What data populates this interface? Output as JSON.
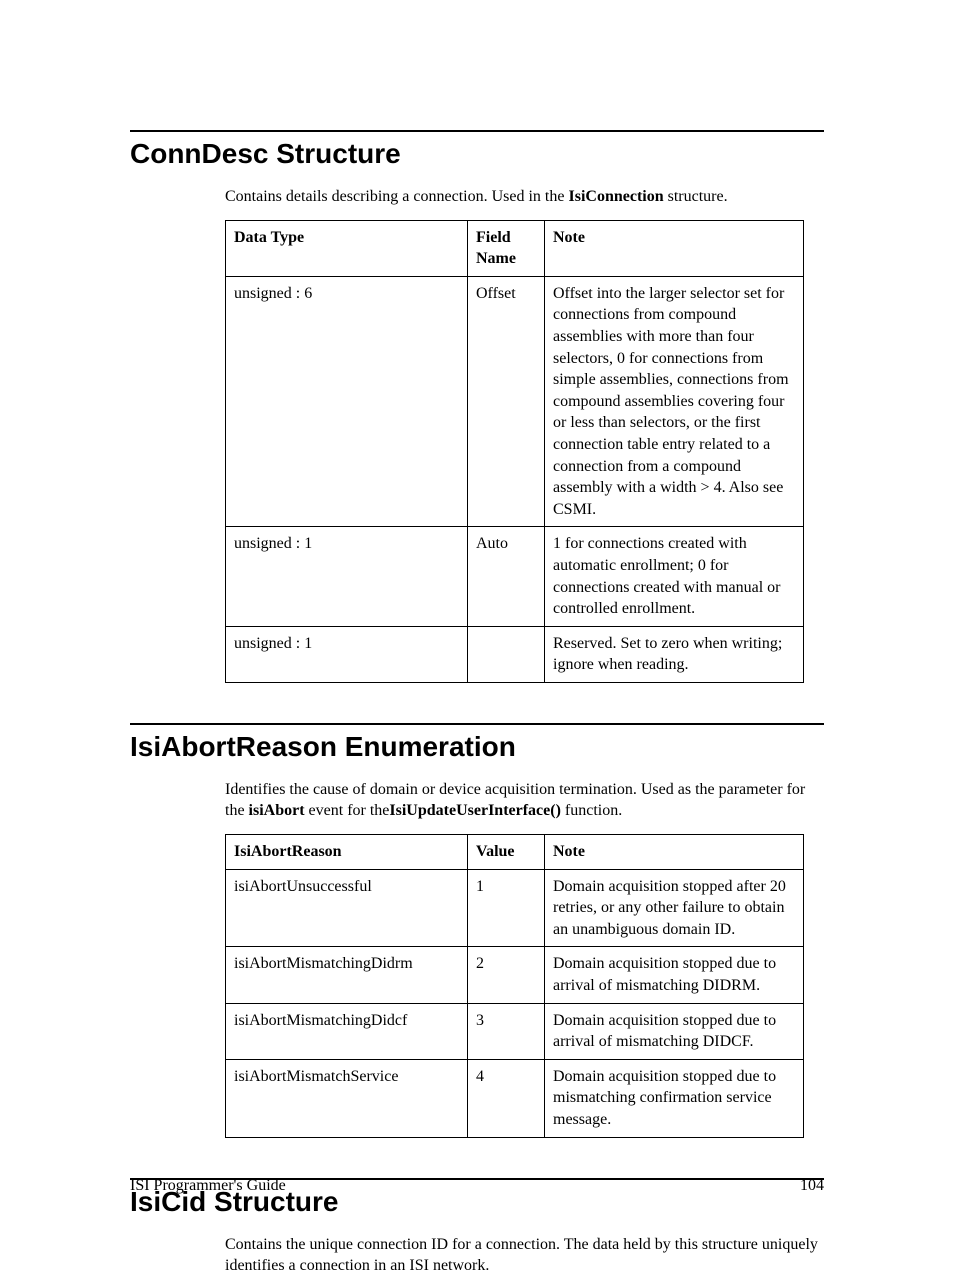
{
  "sections": [
    {
      "heading": "ConnDesc Structure",
      "intro_parts": [
        "Contains details describing a connection.  Used in the ",
        "IsiConnection",
        " structure."
      ],
      "table": {
        "headers": [
          "Data Type",
          "Field Name",
          "Note"
        ],
        "rows": [
          {
            "c0": "unsigned : 6",
            "c1": "Offset",
            "c2": "Offset into the larger selector set for connections from compound assemblies with more than four selectors, 0 for connections from simple assemblies, connections from compound assemblies covering four or less than selectors, or the first connection table entry related to a connection from a compound assembly with a width > 4.  Also see CSMI."
          },
          {
            "c0": "unsigned : 1",
            "c1": "Auto",
            "c2": "1 for connections created with automatic enrollment; 0 for connections created with manual or controlled enrollment."
          },
          {
            "c0": "unsigned : 1",
            "c1": "",
            "c2": "Reserved.  Set to zero when writing; ignore when reading."
          }
        ]
      }
    },
    {
      "heading": "IsiAbortReason Enumeration",
      "intro_parts": [
        "Identifies the cause of domain or device acquisition termination.  Used as the parameter for the ",
        "isiAbort",
        " event for the",
        "IsiUpdateUserInterface()",
        " function."
      ],
      "table": {
        "headers": [
          "IsiAbortReason",
          "Value",
          "Note"
        ],
        "center_col1": true,
        "rows": [
          {
            "c0": "isiAbortUnsuccessful",
            "c1": "1",
            "c2": "Domain acquisition stopped after 20 retries, or any other failure to obtain an unambiguous domain ID."
          },
          {
            "c0": "isiAbortMismatchingDidrm",
            "c1": "2",
            "c2": "Domain acquisition stopped due to arrival of mismatching DIDRM."
          },
          {
            "c0": "isiAbortMismatchingDidcf",
            "c1": "3",
            "c2": "Domain acquisition stopped due to arrival of mismatching DIDCF."
          },
          {
            "c0": "isiAbortMismatchService",
            "c1": "4",
            "c2": "Domain acquisition stopped due to mismatching confirmation service message."
          }
        ]
      }
    },
    {
      "heading": "IsiCid Structure",
      "intro_plain": "Contains the unique connection ID for a connection.  The data held by this structure uniquely identifies a connection in an ISI network."
    }
  ],
  "footer": {
    "left": "ISI Programmer's Guide",
    "right": "104"
  }
}
